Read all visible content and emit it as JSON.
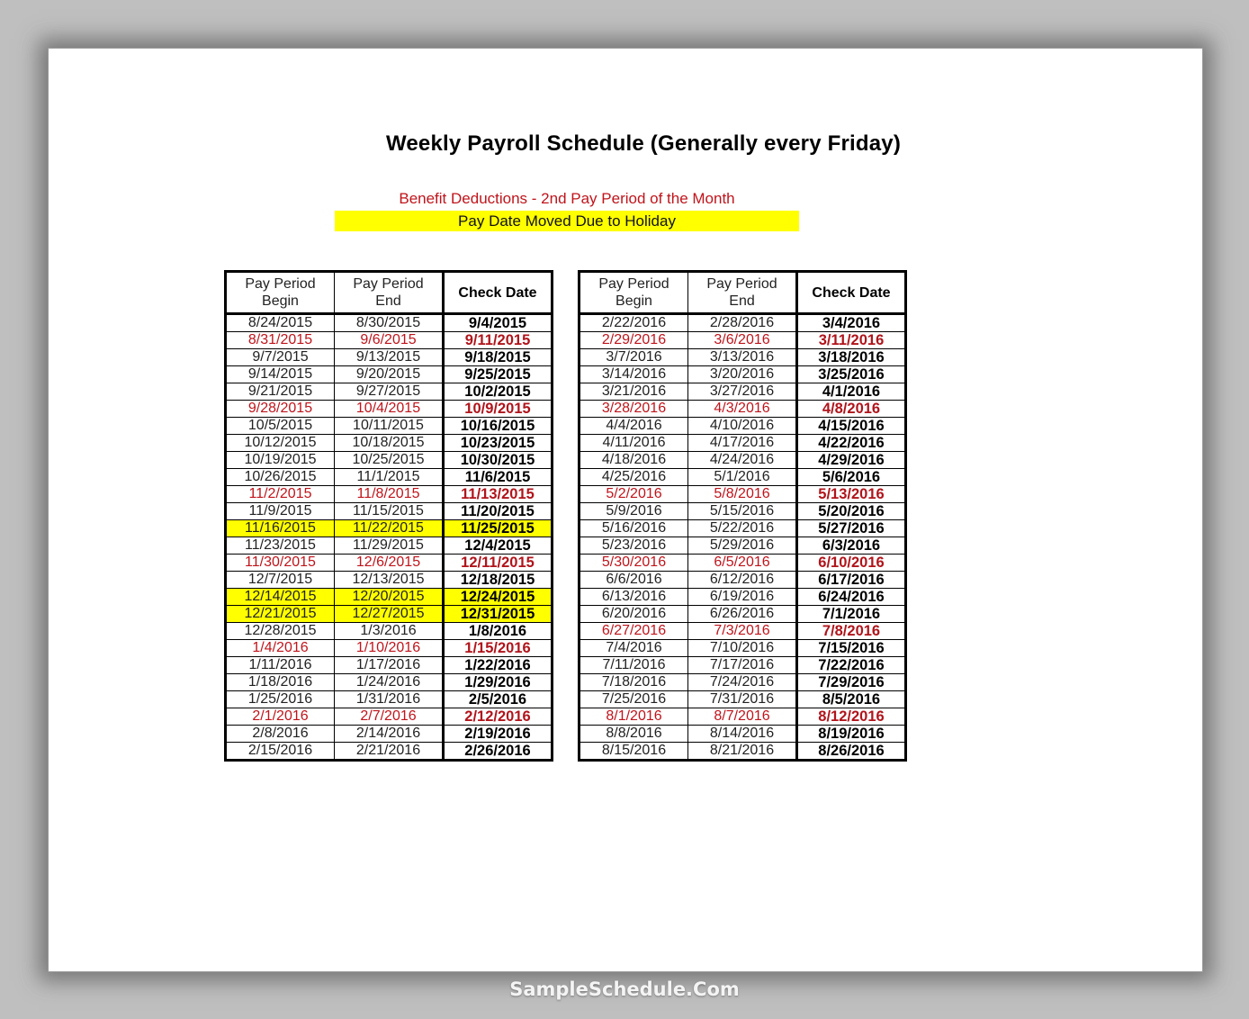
{
  "document": {
    "title": "Weekly Payroll Schedule (Generally every Friday)",
    "legend": {
      "benefit_label": "Benefit Deductions - 2nd Pay Period of the Month",
      "benefit_color": "#c0141b",
      "holiday_label": "Pay Date Moved Due to Holiday",
      "holiday_color": "#ffff00"
    },
    "headers": {
      "begin_line1": "Pay Period",
      "begin_line2": "Begin",
      "end_line1": "Pay Period",
      "end_line2": "End",
      "check": "Check Date"
    },
    "left_table": [
      {
        "begin": "8/24/2015",
        "end": "8/30/2015",
        "check": "9/4/2015",
        "type": "normal"
      },
      {
        "begin": "8/31/2015",
        "end": "9/6/2015",
        "check": "9/11/2015",
        "type": "benefit"
      },
      {
        "begin": "9/7/2015",
        "end": "9/13/2015",
        "check": "9/18/2015",
        "type": "normal"
      },
      {
        "begin": "9/14/2015",
        "end": "9/20/2015",
        "check": "9/25/2015",
        "type": "normal"
      },
      {
        "begin": "9/21/2015",
        "end": "9/27/2015",
        "check": "10/2/2015",
        "type": "normal"
      },
      {
        "begin": "9/28/2015",
        "end": "10/4/2015",
        "check": "10/9/2015",
        "type": "benefit"
      },
      {
        "begin": "10/5/2015",
        "end": "10/11/2015",
        "check": "10/16/2015",
        "type": "normal"
      },
      {
        "begin": "10/12/2015",
        "end": "10/18/2015",
        "check": "10/23/2015",
        "type": "normal"
      },
      {
        "begin": "10/19/2015",
        "end": "10/25/2015",
        "check": "10/30/2015",
        "type": "normal"
      },
      {
        "begin": "10/26/2015",
        "end": "11/1/2015",
        "check": "11/6/2015",
        "type": "normal"
      },
      {
        "begin": "11/2/2015",
        "end": "11/8/2015",
        "check": "11/13/2015",
        "type": "benefit"
      },
      {
        "begin": "11/9/2015",
        "end": "11/15/2015",
        "check": "11/20/2015",
        "type": "normal"
      },
      {
        "begin": "11/16/2015",
        "end": "11/22/2015",
        "check": "11/25/2015",
        "type": "holiday"
      },
      {
        "begin": "11/23/2015",
        "end": "11/29/2015",
        "check": "12/4/2015",
        "type": "normal"
      },
      {
        "begin": "11/30/2015",
        "end": "12/6/2015",
        "check": "12/11/2015",
        "type": "benefit"
      },
      {
        "begin": "12/7/2015",
        "end": "12/13/2015",
        "check": "12/18/2015",
        "type": "normal"
      },
      {
        "begin": "12/14/2015",
        "end": "12/20/2015",
        "check": "12/24/2015",
        "type": "holiday"
      },
      {
        "begin": "12/21/2015",
        "end": "12/27/2015",
        "check": "12/31/2015",
        "type": "holiday"
      },
      {
        "begin": "12/28/2015",
        "end": "1/3/2016",
        "check": "1/8/2016",
        "type": "normal"
      },
      {
        "begin": "1/4/2016",
        "end": "1/10/2016",
        "check": "1/15/2016",
        "type": "benefit"
      },
      {
        "begin": "1/11/2016",
        "end": "1/17/2016",
        "check": "1/22/2016",
        "type": "normal"
      },
      {
        "begin": "1/18/2016",
        "end": "1/24/2016",
        "check": "1/29/2016",
        "type": "normal"
      },
      {
        "begin": "1/25/2016",
        "end": "1/31/2016",
        "check": "2/5/2016",
        "type": "normal"
      },
      {
        "begin": "2/1/2016",
        "end": "2/7/2016",
        "check": "2/12/2016",
        "type": "benefit"
      },
      {
        "begin": "2/8/2016",
        "end": "2/14/2016",
        "check": "2/19/2016",
        "type": "normal"
      },
      {
        "begin": "2/15/2016",
        "end": "2/21/2016",
        "check": "2/26/2016",
        "type": "normal"
      }
    ],
    "right_table": [
      {
        "begin": "2/22/2016",
        "end": "2/28/2016",
        "check": "3/4/2016",
        "type": "normal"
      },
      {
        "begin": "2/29/2016",
        "end": "3/6/2016",
        "check": "3/11/2016",
        "type": "benefit"
      },
      {
        "begin": "3/7/2016",
        "end": "3/13/2016",
        "check": "3/18/2016",
        "type": "normal"
      },
      {
        "begin": "3/14/2016",
        "end": "3/20/2016",
        "check": "3/25/2016",
        "type": "normal"
      },
      {
        "begin": "3/21/2016",
        "end": "3/27/2016",
        "check": "4/1/2016",
        "type": "normal"
      },
      {
        "begin": "3/28/2016",
        "end": "4/3/2016",
        "check": "4/8/2016",
        "type": "benefit"
      },
      {
        "begin": "4/4/2016",
        "end": "4/10/2016",
        "check": "4/15/2016",
        "type": "normal"
      },
      {
        "begin": "4/11/2016",
        "end": "4/17/2016",
        "check": "4/22/2016",
        "type": "normal"
      },
      {
        "begin": "4/18/2016",
        "end": "4/24/2016",
        "check": "4/29/2016",
        "type": "normal"
      },
      {
        "begin": "4/25/2016",
        "end": "5/1/2016",
        "check": "5/6/2016",
        "type": "normal"
      },
      {
        "begin": "5/2/2016",
        "end": "5/8/2016",
        "check": "5/13/2016",
        "type": "benefit"
      },
      {
        "begin": "5/9/2016",
        "end": "5/15/2016",
        "check": "5/20/2016",
        "type": "normal"
      },
      {
        "begin": "5/16/2016",
        "end": "5/22/2016",
        "check": "5/27/2016",
        "type": "normal"
      },
      {
        "begin": "5/23/2016",
        "end": "5/29/2016",
        "check": "6/3/2016",
        "type": "normal"
      },
      {
        "begin": "5/30/2016",
        "end": "6/5/2016",
        "check": "6/10/2016",
        "type": "benefit"
      },
      {
        "begin": "6/6/2016",
        "end": "6/12/2016",
        "check": "6/17/2016",
        "type": "normal"
      },
      {
        "begin": "6/13/2016",
        "end": "6/19/2016",
        "check": "6/24/2016",
        "type": "normal"
      },
      {
        "begin": "6/20/2016",
        "end": "6/26/2016",
        "check": "7/1/2016",
        "type": "normal"
      },
      {
        "begin": "6/27/2016",
        "end": "7/3/2016",
        "check": "7/8/2016",
        "type": "benefit"
      },
      {
        "begin": "7/4/2016",
        "end": "7/10/2016",
        "check": "7/15/2016",
        "type": "normal"
      },
      {
        "begin": "7/11/2016",
        "end": "7/17/2016",
        "check": "7/22/2016",
        "type": "normal"
      },
      {
        "begin": "7/18/2016",
        "end": "7/24/2016",
        "check": "7/29/2016",
        "type": "normal"
      },
      {
        "begin": "7/25/2016",
        "end": "7/31/2016",
        "check": "8/5/2016",
        "type": "normal"
      },
      {
        "begin": "8/1/2016",
        "end": "8/7/2016",
        "check": "8/12/2016",
        "type": "benefit"
      },
      {
        "begin": "8/8/2016",
        "end": "8/14/2016",
        "check": "8/19/2016",
        "type": "normal"
      },
      {
        "begin": "8/15/2016",
        "end": "8/21/2016",
        "check": "8/26/2016",
        "type": "normal"
      }
    ]
  },
  "watermark": "SampleSchedule.Com"
}
